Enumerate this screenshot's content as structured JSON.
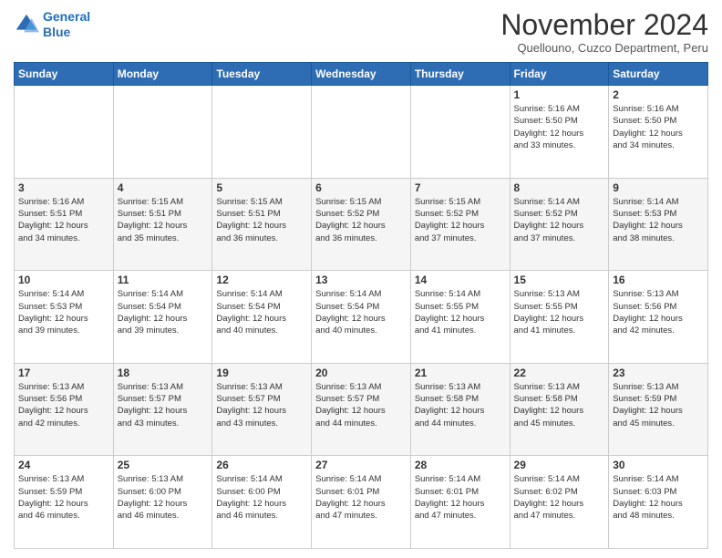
{
  "header": {
    "logo_line1": "General",
    "logo_line2": "Blue",
    "main_title": "November 2024",
    "subtitle": "Quellouno, Cuzco Department, Peru"
  },
  "weekdays": [
    "Sunday",
    "Monday",
    "Tuesday",
    "Wednesday",
    "Thursday",
    "Friday",
    "Saturday"
  ],
  "weeks": [
    [
      {
        "day": "",
        "info": ""
      },
      {
        "day": "",
        "info": ""
      },
      {
        "day": "",
        "info": ""
      },
      {
        "day": "",
        "info": ""
      },
      {
        "day": "",
        "info": ""
      },
      {
        "day": "1",
        "info": "Sunrise: 5:16 AM\nSunset: 5:50 PM\nDaylight: 12 hours\nand 33 minutes."
      },
      {
        "day": "2",
        "info": "Sunrise: 5:16 AM\nSunset: 5:50 PM\nDaylight: 12 hours\nand 34 minutes."
      }
    ],
    [
      {
        "day": "3",
        "info": "Sunrise: 5:16 AM\nSunset: 5:51 PM\nDaylight: 12 hours\nand 34 minutes."
      },
      {
        "day": "4",
        "info": "Sunrise: 5:15 AM\nSunset: 5:51 PM\nDaylight: 12 hours\nand 35 minutes."
      },
      {
        "day": "5",
        "info": "Sunrise: 5:15 AM\nSunset: 5:51 PM\nDaylight: 12 hours\nand 36 minutes."
      },
      {
        "day": "6",
        "info": "Sunrise: 5:15 AM\nSunset: 5:52 PM\nDaylight: 12 hours\nand 36 minutes."
      },
      {
        "day": "7",
        "info": "Sunrise: 5:15 AM\nSunset: 5:52 PM\nDaylight: 12 hours\nand 37 minutes."
      },
      {
        "day": "8",
        "info": "Sunrise: 5:14 AM\nSunset: 5:52 PM\nDaylight: 12 hours\nand 37 minutes."
      },
      {
        "day": "9",
        "info": "Sunrise: 5:14 AM\nSunset: 5:53 PM\nDaylight: 12 hours\nand 38 minutes."
      }
    ],
    [
      {
        "day": "10",
        "info": "Sunrise: 5:14 AM\nSunset: 5:53 PM\nDaylight: 12 hours\nand 39 minutes."
      },
      {
        "day": "11",
        "info": "Sunrise: 5:14 AM\nSunset: 5:54 PM\nDaylight: 12 hours\nand 39 minutes."
      },
      {
        "day": "12",
        "info": "Sunrise: 5:14 AM\nSunset: 5:54 PM\nDaylight: 12 hours\nand 40 minutes."
      },
      {
        "day": "13",
        "info": "Sunrise: 5:14 AM\nSunset: 5:54 PM\nDaylight: 12 hours\nand 40 minutes."
      },
      {
        "day": "14",
        "info": "Sunrise: 5:14 AM\nSunset: 5:55 PM\nDaylight: 12 hours\nand 41 minutes."
      },
      {
        "day": "15",
        "info": "Sunrise: 5:13 AM\nSunset: 5:55 PM\nDaylight: 12 hours\nand 41 minutes."
      },
      {
        "day": "16",
        "info": "Sunrise: 5:13 AM\nSunset: 5:56 PM\nDaylight: 12 hours\nand 42 minutes."
      }
    ],
    [
      {
        "day": "17",
        "info": "Sunrise: 5:13 AM\nSunset: 5:56 PM\nDaylight: 12 hours\nand 42 minutes."
      },
      {
        "day": "18",
        "info": "Sunrise: 5:13 AM\nSunset: 5:57 PM\nDaylight: 12 hours\nand 43 minutes."
      },
      {
        "day": "19",
        "info": "Sunrise: 5:13 AM\nSunset: 5:57 PM\nDaylight: 12 hours\nand 43 minutes."
      },
      {
        "day": "20",
        "info": "Sunrise: 5:13 AM\nSunset: 5:57 PM\nDaylight: 12 hours\nand 44 minutes."
      },
      {
        "day": "21",
        "info": "Sunrise: 5:13 AM\nSunset: 5:58 PM\nDaylight: 12 hours\nand 44 minutes."
      },
      {
        "day": "22",
        "info": "Sunrise: 5:13 AM\nSunset: 5:58 PM\nDaylight: 12 hours\nand 45 minutes."
      },
      {
        "day": "23",
        "info": "Sunrise: 5:13 AM\nSunset: 5:59 PM\nDaylight: 12 hours\nand 45 minutes."
      }
    ],
    [
      {
        "day": "24",
        "info": "Sunrise: 5:13 AM\nSunset: 5:59 PM\nDaylight: 12 hours\nand 46 minutes."
      },
      {
        "day": "25",
        "info": "Sunrise: 5:13 AM\nSunset: 6:00 PM\nDaylight: 12 hours\nand 46 minutes."
      },
      {
        "day": "26",
        "info": "Sunrise: 5:14 AM\nSunset: 6:00 PM\nDaylight: 12 hours\nand 46 minutes."
      },
      {
        "day": "27",
        "info": "Sunrise: 5:14 AM\nSunset: 6:01 PM\nDaylight: 12 hours\nand 47 minutes."
      },
      {
        "day": "28",
        "info": "Sunrise: 5:14 AM\nSunset: 6:01 PM\nDaylight: 12 hours\nand 47 minutes."
      },
      {
        "day": "29",
        "info": "Sunrise: 5:14 AM\nSunset: 6:02 PM\nDaylight: 12 hours\nand 47 minutes."
      },
      {
        "day": "30",
        "info": "Sunrise: 5:14 AM\nSunset: 6:03 PM\nDaylight: 12 hours\nand 48 minutes."
      }
    ]
  ]
}
